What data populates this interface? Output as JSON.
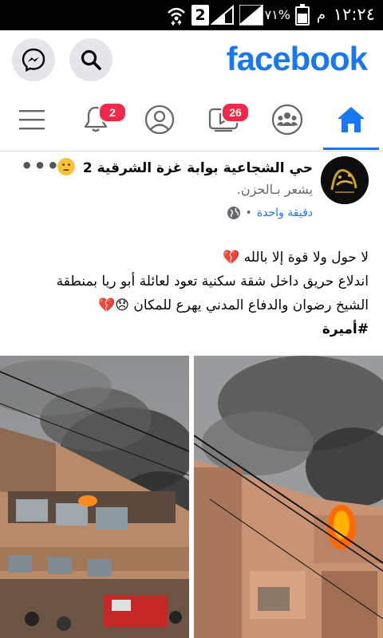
{
  "status_bar": {
    "time": "١٢:٢٤",
    "ampm": "م",
    "battery_percent": "٧١%",
    "sim_label": "2"
  },
  "header": {
    "logo": "facebook",
    "icons": [
      "messenger-icon",
      "search-icon"
    ],
    "brand_color": "#1877f2"
  },
  "nav": {
    "tabs": [
      {
        "name": "menu",
        "icon": "hamburger-icon"
      },
      {
        "name": "notifications",
        "icon": "bell-icon",
        "badge": "2"
      },
      {
        "name": "profile",
        "icon": "profile-icon"
      },
      {
        "name": "watch",
        "icon": "video-icon",
        "badge": "26"
      },
      {
        "name": "groups",
        "icon": "groups-icon"
      },
      {
        "name": "home",
        "icon": "home-icon",
        "active": true
      }
    ]
  },
  "post": {
    "page_name": "حي الشجاعية بوابة غزة الشرقية 2",
    "feeling": "يشعر بـالحزن.",
    "time": "دقيقة واحدة",
    "privacy_icon": "globe-icon",
    "more_label": "•••",
    "lines": [
      "لا حول ولا قوة إلا بالله 💔",
      "اندلاع حريق داخل شقة سكنية تعود لعائلة أبو ريا بمنطقة",
      "الشيخ رضوان والدفاع المدني يهرع للمكان 😞💔"
    ],
    "hashtag": "#أميرة",
    "photos": [
      "building-fire-photo-left",
      "building-fire-photo-right"
    ]
  }
}
